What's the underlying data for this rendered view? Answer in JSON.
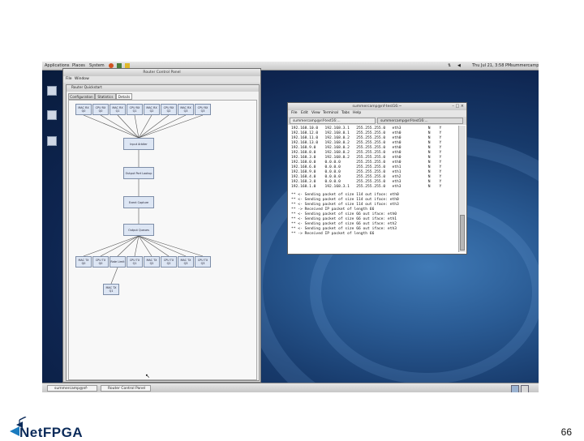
{
  "topbar": {
    "menus": [
      "Applications",
      "Places",
      "System"
    ],
    "datetime": "Thu Jul 21, 3:58 PM",
    "user": "summercamp"
  },
  "taskbar": {
    "items": [
      "summercamp@nf-test...",
      "Router Control Panel"
    ]
  },
  "router_window": {
    "title": "Router Control Panel",
    "menu": [
      "File",
      "Window"
    ],
    "inner_title": "Router Quickstart",
    "tabs": [
      "Configuration",
      "Statistics",
      "Details"
    ],
    "active_tab": "Details",
    "top_row": [
      "MAC RX Q0",
      "CPU RX Q0",
      "MAC RX Q1",
      "CPU RX Q1",
      "MAC RX Q2",
      "CPU RX Q2",
      "MAC RX Q3",
      "CPU RX Q3"
    ],
    "pipeline": [
      "Input Arbiter",
      "Output Port Lookup",
      "Event Capture",
      "Output Queues"
    ],
    "bottom_row": [
      "MAC TX Q0",
      "CPU TX Q0",
      "Rate Limit",
      "CPU TX Q1",
      "MAC TX Q2",
      "CPU TX Q2",
      "MAC TX Q3",
      "CPU TX Q3"
    ],
    "extra_node": "MAC TX Q1"
  },
  "terminal": {
    "title": "summercamp@nf-test16:~",
    "menu": [
      "File",
      "Edit",
      "View",
      "Terminal",
      "Tabs",
      "Help"
    ],
    "tabs": [
      "summercamp@nf-test16:...",
      "summercamp@nf-test16:..."
    ],
    "routes": [
      [
        "192.168.10.0",
        "192.168.3.1",
        "255.255.255.0",
        "eth3",
        "N",
        "Y"
      ],
      [
        "192.168.12.0",
        "192.168.0.1",
        "255.255.255.0",
        "eth0",
        "N",
        "Y"
      ],
      [
        "192.168.11.0",
        "192.168.0.2",
        "255.255.255.0",
        "eth0",
        "N",
        "Y"
      ],
      [
        "192.168.13.0",
        "192.168.0.2",
        "255.255.255.0",
        "eth0",
        "N",
        "Y"
      ],
      [
        "192.168.9.0",
        "192.168.0.2",
        "255.255.255.0",
        "eth0",
        "N",
        "Y"
      ],
      [
        "192.168.8.0",
        "192.168.0.2",
        "255.255.255.0",
        "eth0",
        "N",
        "Y"
      ],
      [
        "192.168.3.0",
        "192.168.0.2",
        "255.255.255.0",
        "eth0",
        "N",
        "Y"
      ],
      [
        "192.168.0.0",
        "0.0.0.0",
        "255.255.255.0",
        "eth0",
        "N",
        "Y"
      ],
      [
        "192.168.6.0",
        "0.0.0.0",
        "255.255.255.0",
        "eth1",
        "N",
        "Y"
      ],
      [
        "192.168.9.0",
        "0.0.0.0",
        "255.255.255.0",
        "eth1",
        "N",
        "Y"
      ],
      [
        "192.168.4.0",
        "0.0.0.0",
        "255.255.255.0",
        "eth2",
        "N",
        "Y"
      ],
      [
        "192.168.3.0",
        "0.0.0.0",
        "255.255.255.0",
        "eth3",
        "N",
        "Y"
      ],
      [
        "192.168.1.0",
        "192.168.3.1",
        "255.255.255.0",
        "eth3",
        "N",
        "Y"
      ]
    ],
    "log": [
      "** <- Sending packet of size 114 out iface: eth0",
      "** <- Sending packet of size 114 out iface: eth0",
      "** <- Sending packet of size 114 out iface: eth3",
      "** -> Received IP packet of length 66",
      "** <- Sending packet of size 66 out iface: eth0",
      "** <- Sending packet of size 66 out iface: eth1",
      "** <- Sending packet of size 66 out iface: eth2",
      "** <- Sending packet of size 66 out iface: eth3",
      "** -> Received IP packet of length 66"
    ]
  },
  "footer": {
    "logo_text": "NetFPGA",
    "page_number": "66"
  }
}
